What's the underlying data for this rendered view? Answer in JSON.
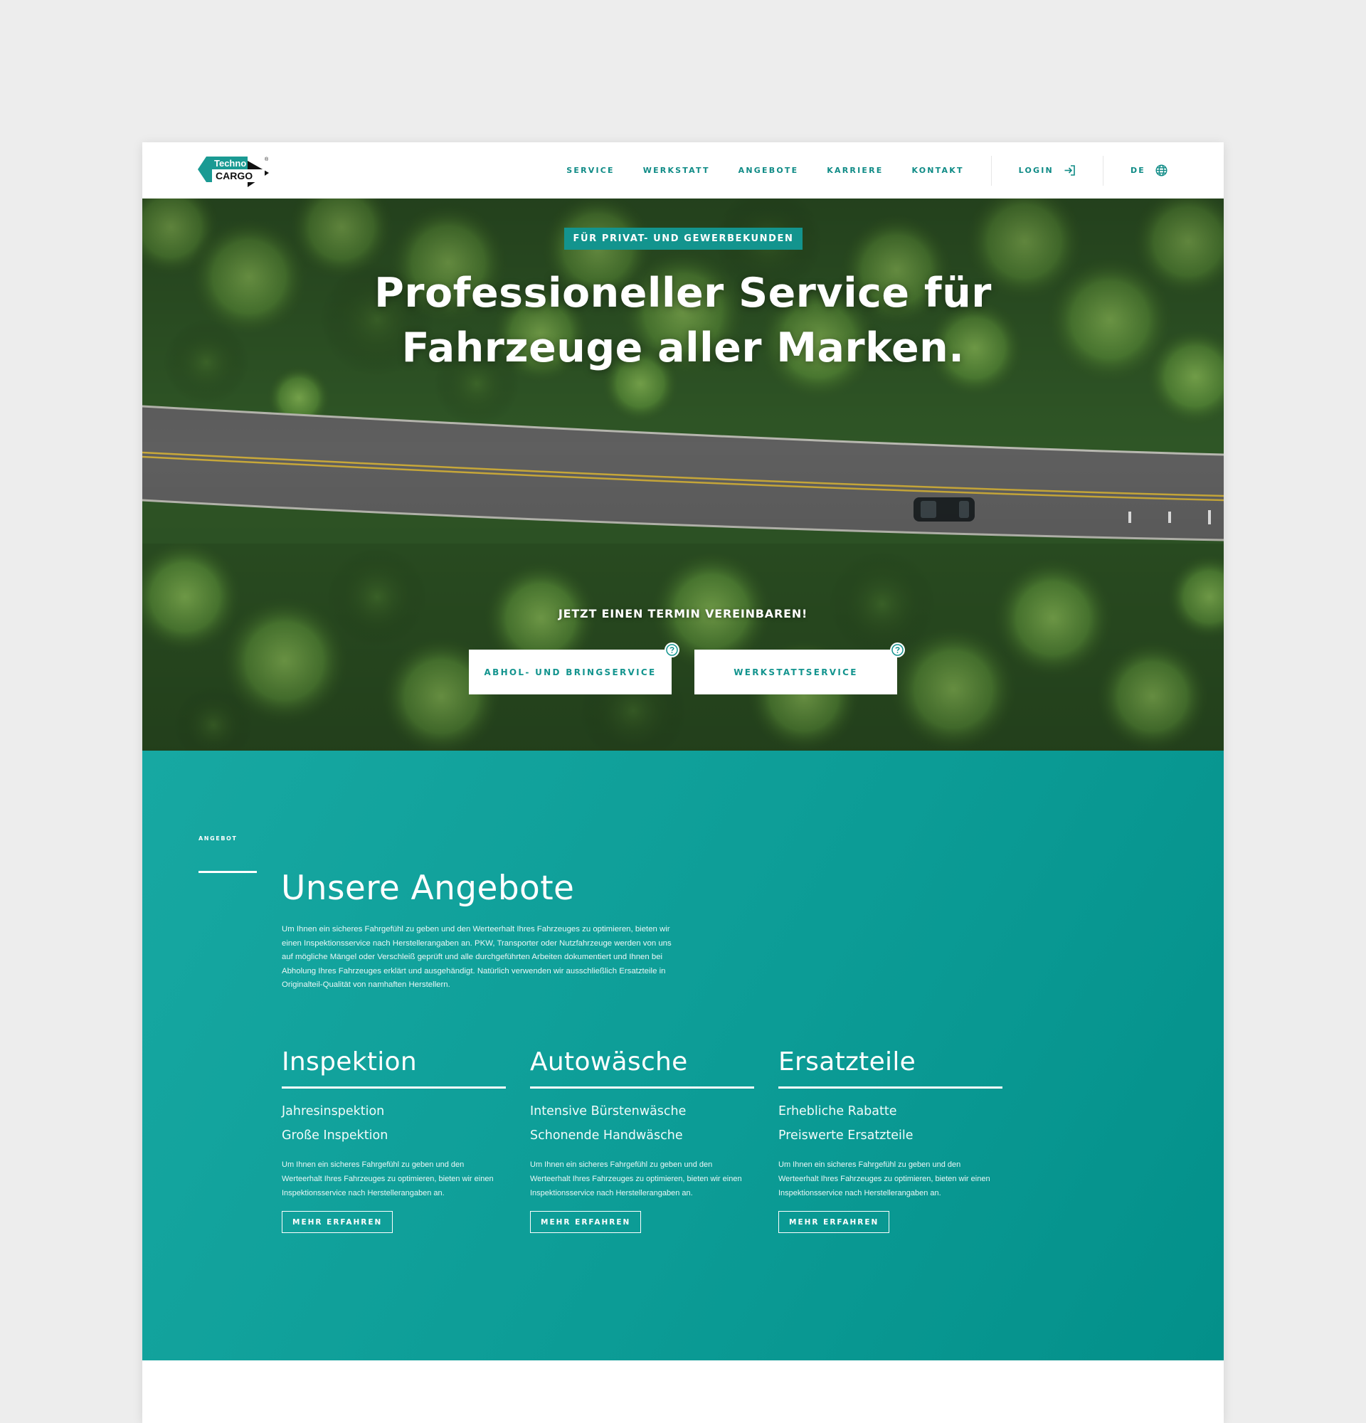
{
  "brand": {
    "logo_text_top": "Techno",
    "logo_text_bottom": "CARGO",
    "registered_mark": "®",
    "accent_color": "#13948e",
    "logo_color": "#1a9a93"
  },
  "nav": {
    "items": [
      {
        "label": "SERVICE"
      },
      {
        "label": "WERKSTATT"
      },
      {
        "label": "ANGEBOTE"
      },
      {
        "label": "KARRIERE"
      },
      {
        "label": "KONTAKT"
      }
    ],
    "login_label": "LOGIN",
    "login_icon": "login-arrow-icon",
    "language_label": "DE",
    "language_icon": "globe-icon"
  },
  "hero": {
    "badge": "FÜR PRIVAT- UND GEWERBEKUNDEN",
    "title_line1": "Professioneller Service für",
    "title_line2": "Fahrzeuge aller Marken.",
    "cta_label": "JETZT EINEN TERMIN VEREINBAREN!",
    "buttons": [
      {
        "label": "ABHOL- UND BRINGSERVICE",
        "icon": "question-circle-icon"
      },
      {
        "label": "WERKSTATTSERVICE",
        "icon": "question-circle-icon"
      }
    ]
  },
  "offers": {
    "eyebrow": "ANGEBOT",
    "title": "Unsere Angebote",
    "intro": "Um Ihnen ein sicheres Fahrgefühl zu geben und den Werteerhalt Ihres Fahrzeuges zu optimieren, bieten wir einen Inspektionsservice nach Herstellerangaben an. PKW, Transporter oder Nutzfahrzeuge werden von uns auf mögliche Mängel oder Verschleiß geprüft und alle durchgeführten Arbeiten dokumentiert und Ihnen bei Abholung Ihres Fahrzeuges erklärt und ausgehändigt. Natürlich verwenden wir ausschließlich Ersatzteile in Originalteil-Qualität von namhaften Herstellern.",
    "columns": [
      {
        "title": "Inspektion",
        "items": [
          "Jahresinspektion",
          "Große Inspektion"
        ],
        "text": "Um Ihnen ein sicheres Fahrgefühl zu geben und den Werteerhalt Ihres Fahrzeuges zu optimieren, bieten wir einen Inspektionsservice nach Herstellerangaben an.",
        "button": "MEHR ERFAHREN"
      },
      {
        "title": "Autowäsche",
        "items": [
          "Intensive Bürstenwäsche",
          "Schonende Handwäsche"
        ],
        "text": "Um Ihnen ein sicheres Fahrgefühl zu geben und den Werteerhalt Ihres Fahrzeuges zu optimieren, bieten wir einen Inspektionsservice nach Herstellerangaben an.",
        "button": "MEHR ERFAHREN"
      },
      {
        "title": "Ersatzteile",
        "items": [
          "Erhebliche Rabatte",
          "Preiswerte Ersatzteile"
        ],
        "text": "Um Ihnen ein sicheres Fahrgefühl zu geben und den Werteerhalt Ihres Fahrzeuges zu optimieren, bieten wir einen Inspektionsservice nach Herstellerangaben an.",
        "button": "MEHR ERFAHREN"
      }
    ]
  }
}
